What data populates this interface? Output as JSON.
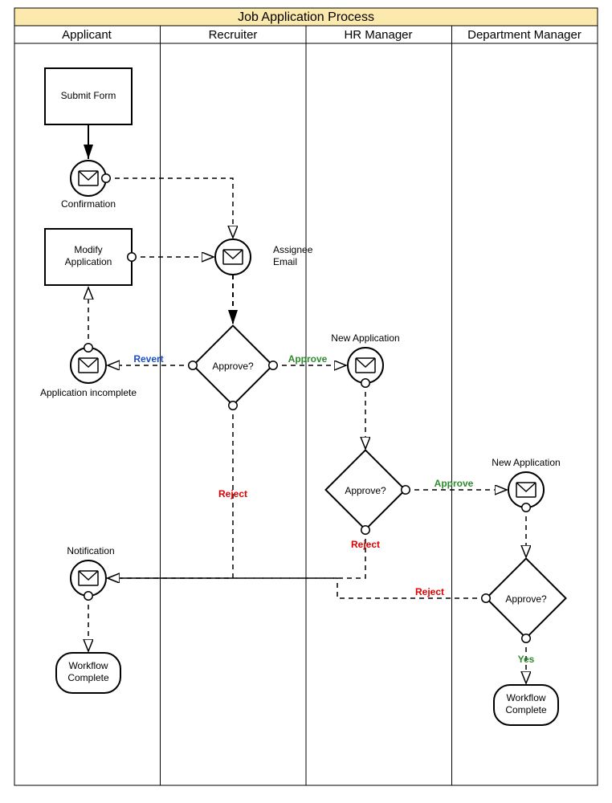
{
  "diagram": {
    "title": "Job Application Process",
    "lanes": [
      "Applicant",
      "Recruiter",
      "HR Manager",
      "Department Manager"
    ],
    "nodes": {
      "submitForm": "Submit Form",
      "confirmation": "Confirmation",
      "modifyApp1": "Modify",
      "modifyApp2": "Application",
      "assigneeEmail1": "Assignee",
      "assigneeEmail2": "Email",
      "approve1": "Approve?",
      "appIncomplete": "Application incomplete",
      "newApp1": "New Application",
      "approve2": "Approve?",
      "newApp2": "New Application",
      "approve3": "Approve?",
      "notification": "Notification",
      "workflowComplete1a": "Workflow",
      "workflowComplete1b": "Complete",
      "workflowComplete2a": "Workflow",
      "workflowComplete2b": "Complete"
    },
    "edges": {
      "revert": "Revert",
      "approveA": "Approve",
      "rejectA": "Reject",
      "approveB": "Approve",
      "rejectB": "Reject",
      "rejectC": "Reject",
      "yes": "Yes"
    },
    "colors": {
      "revert": "#1a4fc9",
      "approve": "#2e8b2e",
      "reject": "#e00000",
      "yes": "#2e8b2e"
    }
  }
}
